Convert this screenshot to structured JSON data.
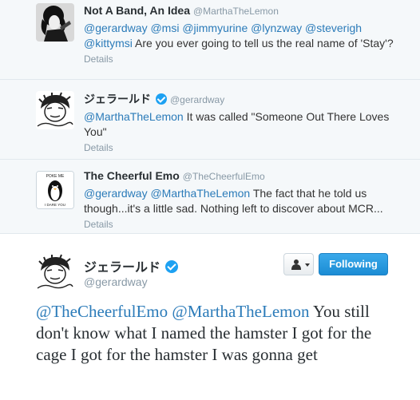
{
  "replies": [
    {
      "name": "Not A Band, An Idea",
      "handle": "@MarthaTheLemon",
      "mentions": "@gerardway @msi @jimmyurine @lynzway @steverigh @kittymsi",
      "text": " Are you ever going to tell us the real name of 'Stay'?",
      "details": "Details"
    },
    {
      "name": "ジェラールド",
      "handle": "@gerardway",
      "mentions": "@MarthaTheLemon",
      "text": " It was called \"Someone Out There Loves You\"",
      "details": "Details"
    },
    {
      "name": "The Cheerful Emo",
      "handle": "@TheCheerfulEmo",
      "mentions": "@gerardway @MarthaTheLemon",
      "text": " The fact that he told us though...it's a little sad. Nothing left to discover about MCR...",
      "details": "Details",
      "avatar_top": "POKE ME",
      "avatar_bottom": "I DARE YOU"
    }
  ],
  "main_tweet": {
    "name": "ジェラールド",
    "handle": "@gerardway",
    "mentions": "@TheCheerfulEmo @MarthaTheLemon",
    "text": " You still don't know what I named the hamster I got for the cage I got for the hamster I was gonna get",
    "follow_label": "Following",
    "user_menu_icon": "user-icon"
  },
  "colors": {
    "link": "#2b7bb9",
    "verified": "#1da1f2",
    "follow_button": "#2a9de2",
    "thread_bg": "#f5f8fa"
  }
}
